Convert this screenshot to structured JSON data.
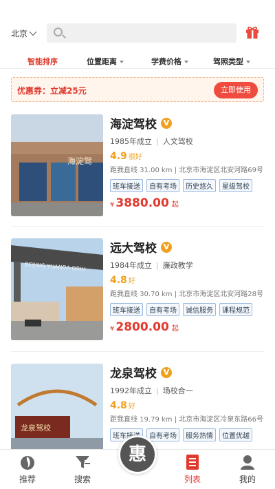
{
  "header": {
    "city": "北京",
    "search_placeholder": ""
  },
  "sort_tabs": [
    {
      "label": "智能排序",
      "active": true
    },
    {
      "label": "位置距离",
      "active": false
    },
    {
      "label": "学费价格",
      "active": false
    },
    {
      "label": "驾照类型",
      "active": false
    }
  ],
  "coupon": {
    "text": "优惠券：立减25元",
    "button": "立即使用"
  },
  "schools": [
    {
      "name": "海淀驾校",
      "badge": "V",
      "founded": "1985年成立",
      "feature": "人文驾校",
      "rating": "4.9",
      "rating_word": "很好",
      "address": "距我直线 31.00 km  |  北京市海淀区北安河路69号",
      "tags": [
        "班车接送",
        "自有考场",
        "历史悠久",
        "星级驾校"
      ],
      "currency": "¥",
      "price": "3880.00",
      "price_suffix": "起",
      "image_sign": "海淀驾"
    },
    {
      "name": "远大驾校",
      "badge": "V",
      "founded": "1984年成立",
      "feature": "廉政教学",
      "rating": "4.8",
      "rating_word": "好",
      "address": "距我直线 30.70 km  |  北京市海淀区北安河路28号",
      "tags": [
        "班车接送",
        "自有考场",
        "诚信服务",
        "课程规范"
      ],
      "currency": "¥",
      "price": "2800.00",
      "price_suffix": "起",
      "image_sign": "BEIJING YUANDA DRIV"
    },
    {
      "name": "龙泉驾校",
      "badge": "V",
      "founded": "1992年成立",
      "feature": "场校合一",
      "rating": "4.8",
      "rating_word": "好",
      "address": "距我直线 19.79 km  |  北京市海淀区冷泉东路66号",
      "tags": [
        "班车接送",
        "自有考场",
        "服务热情",
        "位置优越"
      ],
      "image_sign": "龙泉驾校"
    }
  ],
  "bottom_nav": {
    "items": [
      {
        "label": "推荐",
        "icon": "recommend-icon"
      },
      {
        "label": "搜索",
        "icon": "search-filter-icon"
      },
      {
        "label": "列表",
        "icon": "list-icon",
        "active": true
      },
      {
        "label": "我的",
        "icon": "user-icon"
      }
    ],
    "center": "惠"
  },
  "colors": {
    "accent": "#e03a2e",
    "rating": "#f0a020",
    "tag_border": "#9bb8de"
  }
}
